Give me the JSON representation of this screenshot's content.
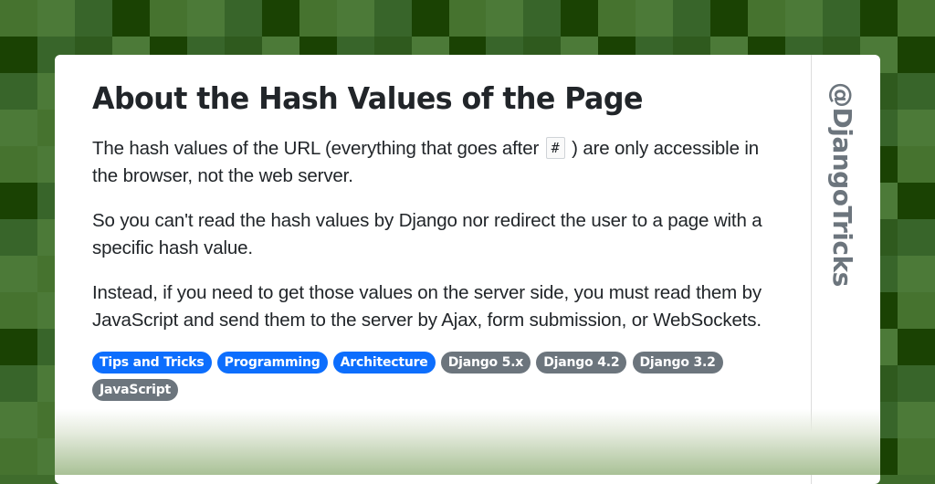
{
  "background": {
    "palette": [
      "#46732f",
      "#4c7a38",
      "#38652a",
      "#1a4203",
      "#2f5a1e",
      "#3e6a2a"
    ],
    "pattern_rows": [
      [
        0,
        1,
        2,
        3
      ],
      [
        3,
        2,
        4,
        1
      ],
      [
        2,
        1,
        0,
        4
      ],
      [
        1,
        0,
        1,
        2
      ]
    ]
  },
  "post": {
    "title": "About the Hash Values of the Page",
    "paragraphs": [
      {
        "before": "The hash values of the URL (everything that goes after ",
        "code": "#",
        "after": " ) are only accessible in the browser, not the web server."
      },
      {
        "text": "So you can't read the hash values by Django nor redirect the user to a page with a specific hash value."
      },
      {
        "text": "Instead, if you need to get those values on the server side, you must read them by JavaScript and send them to the server by Ajax, form submission, or WebSockets."
      }
    ],
    "tags": [
      {
        "label": "Tips and Tricks",
        "variant": "primary"
      },
      {
        "label": "Programming",
        "variant": "primary"
      },
      {
        "label": "Architecture",
        "variant": "primary"
      },
      {
        "label": "Django 5.x",
        "variant": "secondary"
      },
      {
        "label": "Django 4.2",
        "variant": "secondary"
      },
      {
        "label": "Django 3.2",
        "variant": "secondary"
      },
      {
        "label": "JavaScript",
        "variant": "secondary"
      }
    ]
  },
  "brand": {
    "handle": "@DjangoTricks"
  },
  "colors": {
    "tag_primary": "#0d6efd",
    "tag_secondary": "#6c757d",
    "text": "#212529"
  }
}
